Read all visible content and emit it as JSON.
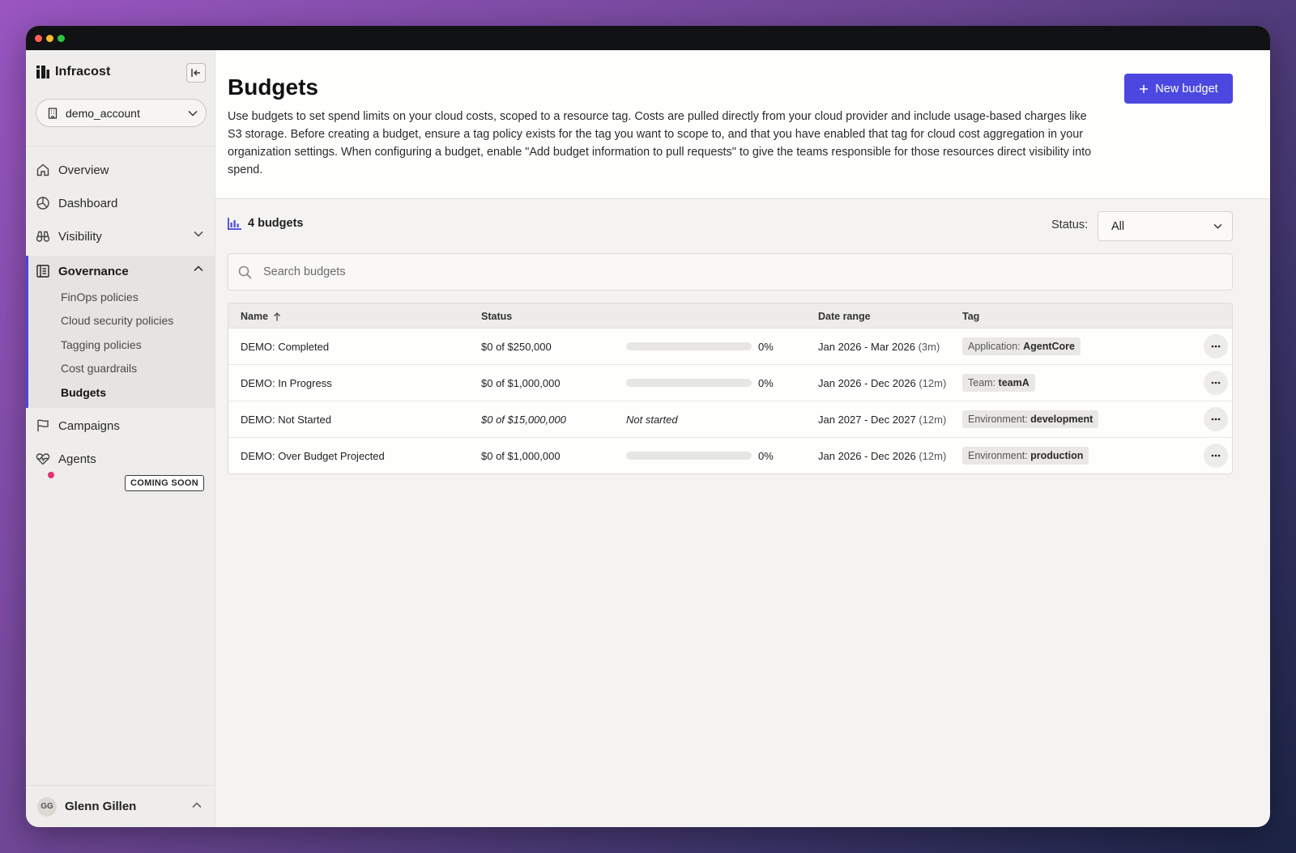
{
  "app": {
    "brand": "Infracost"
  },
  "sidebar": {
    "account": "demo_account",
    "nav": {
      "overview": "Overview",
      "dashboard": "Dashboard",
      "visibility": "Visibility",
      "governance": "Governance",
      "campaigns": "Campaigns",
      "agents": "Agents",
      "agents_badge": "COMING SOON"
    },
    "governance_items": [
      "FinOps policies",
      "Cloud security policies",
      "Tagging policies",
      "Cost guardrails",
      "Budgets"
    ],
    "user": {
      "initials": "GG",
      "name": "Glenn Gillen"
    }
  },
  "page": {
    "title": "Budgets",
    "description": "Use budgets to set spend limits on your cloud costs, scoped to a resource tag. Costs are pulled directly from your cloud provider and include usage-based charges like S3 storage. Before creating a budget, ensure a tag policy exists for the tag you want to scope to, and that you have enabled that tag for cloud cost aggregation in your organization settings. When configuring a budget, enable \"Add budget information to pull requests\" to give the teams responsible for those resources direct visibility into spend.",
    "new_button": "New budget",
    "count_label": "4 budgets",
    "status_filter": {
      "label": "Status:",
      "value": "All"
    },
    "search_placeholder": "Search budgets"
  },
  "table": {
    "columns": {
      "name": "Name",
      "status": "Status",
      "date_range": "Date range",
      "tag": "Tag"
    },
    "rows": [
      {
        "name": "DEMO: Completed",
        "amount": "$0 of $250,000",
        "progress": 0,
        "progress_label": "0%",
        "dates": "Jan 2026 - Mar 2026",
        "duration": "(3m)",
        "tag_key": "Application:",
        "tag_value": "AgentCore"
      },
      {
        "name": "DEMO: In Progress",
        "amount": "$0 of $1,000,000",
        "progress": 0,
        "progress_label": "0%",
        "dates": "Jan 2026 - Dec 2026",
        "duration": "(12m)",
        "tag_key": "Team:",
        "tag_value": "teamA"
      },
      {
        "name": "DEMO: Not Started",
        "amount": "$0 of $15,000,000",
        "state": "Not started",
        "dates": "Jan 2027 - Dec 2027",
        "duration": "(12m)",
        "tag_key": "Environment:",
        "tag_value": "development"
      },
      {
        "name": "DEMO: Over Budget Projected",
        "amount": "$0 of $1,000,000",
        "progress": 0,
        "progress_label": "0%",
        "dates": "Jan 2026 - Dec 2026",
        "duration": "(12m)",
        "tag_key": "Environment:",
        "tag_value": "production"
      }
    ]
  },
  "colors": {
    "accent": "#4b47e0",
    "sidebar_bg": "#efedeb",
    "notification_dot": "#e5307a"
  }
}
